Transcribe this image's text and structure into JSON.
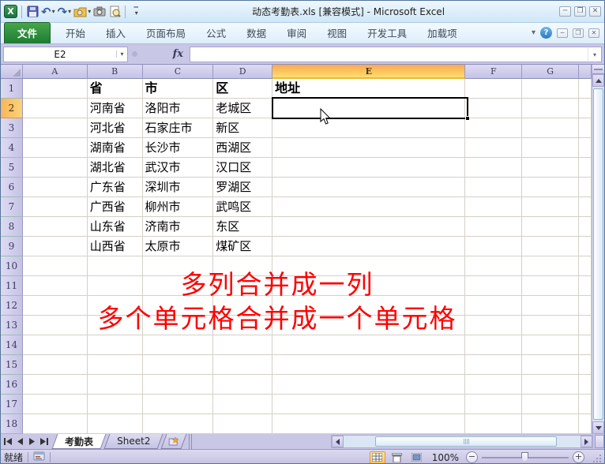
{
  "titlebar": {
    "title": "动态考勤表.xls  [兼容模式] -  Microsoft Excel"
  },
  "qat_icons": [
    "excel-logo",
    "save",
    "undo",
    "redo",
    "screen-clip",
    "camera",
    "print-preview",
    "customize-qat"
  ],
  "ribbon": {
    "tabs": [
      "文件",
      "开始",
      "插入",
      "页面布局",
      "公式",
      "数据",
      "审阅",
      "视图",
      "开发工具",
      "加载项"
    ],
    "active_tab": "文件"
  },
  "formula_bar": {
    "name_box": "E2",
    "fx_label": "fx",
    "formula_value": ""
  },
  "grid": {
    "column_headers": [
      "A",
      "B",
      "C",
      "D",
      "E",
      "F",
      "G"
    ],
    "row_count": 18,
    "selected_cell": "E2",
    "selected_column": "E",
    "selected_row": 2,
    "cells": {
      "B1": "省",
      "C1": "市",
      "D1": "区",
      "E1": "地址",
      "B2": "河南省",
      "C2": "洛阳市",
      "D2": "老城区",
      "E2": "",
      "B3": "河北省",
      "C3": "石家庄市",
      "D3": "新区",
      "B4": "湖南省",
      "C4": "长沙市",
      "D4": "西湖区",
      "B5": "湖北省",
      "C5": "武汉市",
      "D5": "汉口区",
      "B6": "广东省",
      "C6": "深圳市",
      "D6": "罗湖区",
      "B7": "广西省",
      "C7": "柳州市",
      "D7": "武鸣区",
      "B8": "山东省",
      "C8": "济南市",
      "D8": "东区",
      "B9": "山西省",
      "C9": "太原市",
      "D9": "煤矿区"
    },
    "overlay_text": {
      "line1": "多列合并成一列",
      "line2": "多个单元格合并成一个单元格",
      "color": "#ff0000"
    }
  },
  "sheet_tabs": {
    "tabs": [
      {
        "label": "考勤表",
        "active": true
      },
      {
        "label": "Sheet2",
        "active": false
      }
    ]
  },
  "status_bar": {
    "ready_text": "就绪",
    "zoom_level": "100%"
  },
  "colors": {
    "header_selected": "#fbaa4e",
    "file_tab_green": "#1d7c33",
    "overlay_red": "#ff0000",
    "titlebar_blue": "#cfe7f7"
  }
}
